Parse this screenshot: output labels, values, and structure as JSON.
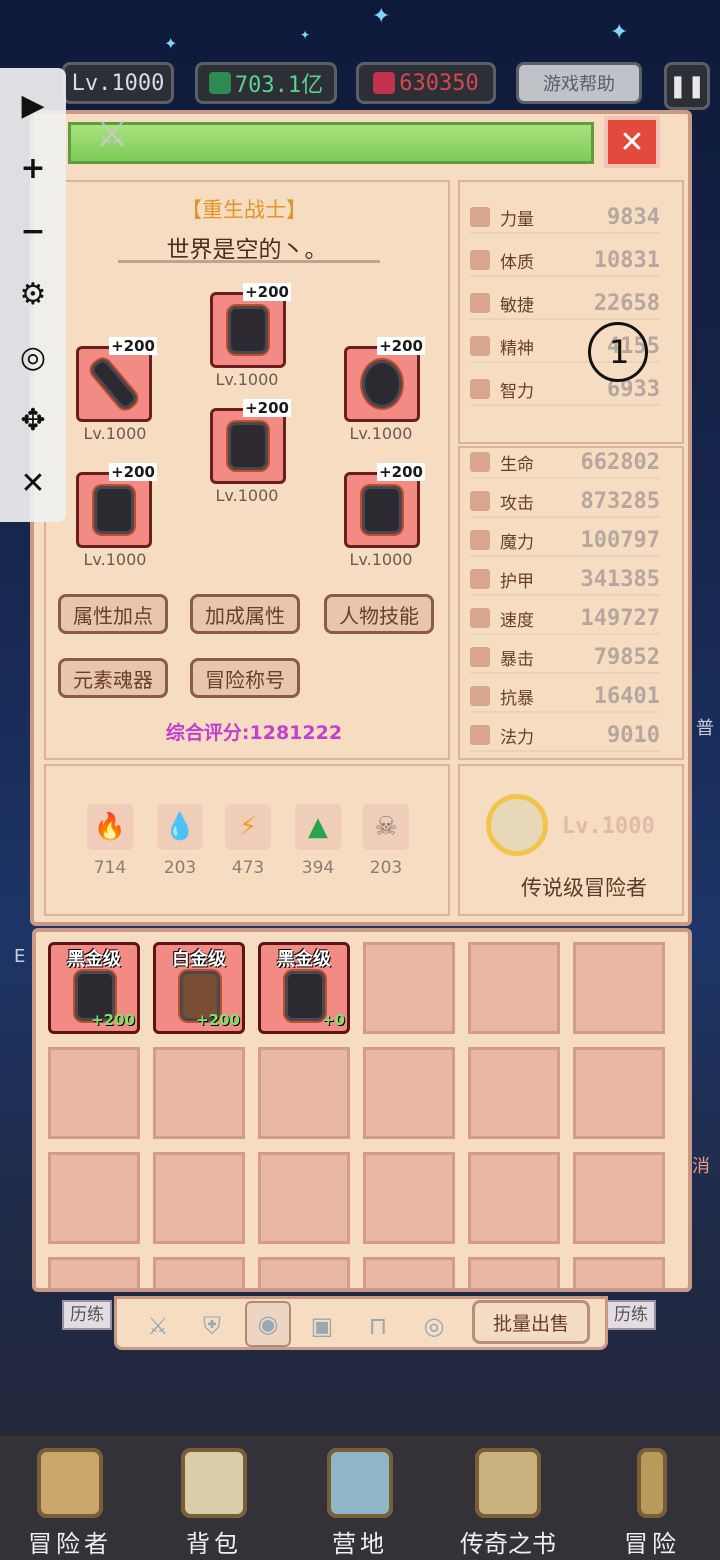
{
  "hud": {
    "level": "Lv.1000",
    "money": "703.1亿",
    "gems": "630350",
    "help": "游戏帮助",
    "pause_icon": "pause-icon"
  },
  "tools": [
    "play-icon",
    "plus-icon",
    "minus-icon",
    "gear-icon",
    "eye-off-icon",
    "move-icon",
    "close-icon"
  ],
  "panel": {
    "class_title": "【重生战士】",
    "player_name": "世界是空的丶。",
    "score": "综合评分:1281222",
    "buttons": [
      "属性加点",
      "加成属性",
      "人物技能",
      "元素魂器",
      "冒险称号"
    ]
  },
  "equipment": [
    {
      "name": "helmet",
      "plus": "+200",
      "level": "Lv.1000"
    },
    {
      "name": "sword",
      "plus": "+200",
      "level": "Lv.1000"
    },
    {
      "name": "shield",
      "plus": "+200",
      "level": "Lv.1000"
    },
    {
      "name": "armor",
      "plus": "+200",
      "level": "Lv.1000"
    },
    {
      "name": "gloves",
      "plus": "+200",
      "level": "Lv.1000"
    },
    {
      "name": "boots",
      "plus": "+200",
      "level": "Lv.1000"
    }
  ],
  "elements": [
    {
      "icon": "fire-icon",
      "value": "714"
    },
    {
      "icon": "water-icon",
      "value": "203"
    },
    {
      "icon": "lightning-icon",
      "value": "473"
    },
    {
      "icon": "earth-icon",
      "value": "394"
    },
    {
      "icon": "skull-icon",
      "value": "203"
    }
  ],
  "base_stats": [
    {
      "label": "力量",
      "value": "9834"
    },
    {
      "label": "体质",
      "value": "10831"
    },
    {
      "label": "敏捷",
      "value": "22658"
    },
    {
      "label": "精神",
      "value": "4155"
    },
    {
      "label": "智力",
      "value": "6933"
    }
  ],
  "combat_stats": [
    {
      "label": "生命",
      "value": "662802"
    },
    {
      "label": "攻击",
      "value": "873285"
    },
    {
      "label": "魔力",
      "value": "100797"
    },
    {
      "label": "护甲",
      "value": "341385"
    },
    {
      "label": "速度",
      "value": "149727"
    },
    {
      "label": "暴击",
      "value": "79852"
    },
    {
      "label": "抗暴",
      "value": "16401"
    },
    {
      "label": "法力",
      "value": "9010"
    }
  ],
  "legend": {
    "level": "Lv.1000",
    "title": "传说级冒险者"
  },
  "inventory": [
    {
      "tier": "黑金级",
      "bonus": "+200"
    },
    {
      "tier": "白金级",
      "bonus": "+200"
    },
    {
      "tier": "黑金级",
      "bonus": "+0"
    }
  ],
  "tabs": [
    "sword-icon",
    "shield-icon",
    "helmet-icon",
    "armor-icon",
    "table-icon",
    "ring-icon"
  ],
  "bulk_sell": "批量出售",
  "side_tags": {
    "left": "历练",
    "right": "历练"
  },
  "edge_text": {
    "right_1": "普",
    "right_2": "消",
    "left_1": "E"
  },
  "bottom_nav": [
    "冒险者",
    "背包",
    "营地",
    "传奇之书",
    "冒险"
  ]
}
